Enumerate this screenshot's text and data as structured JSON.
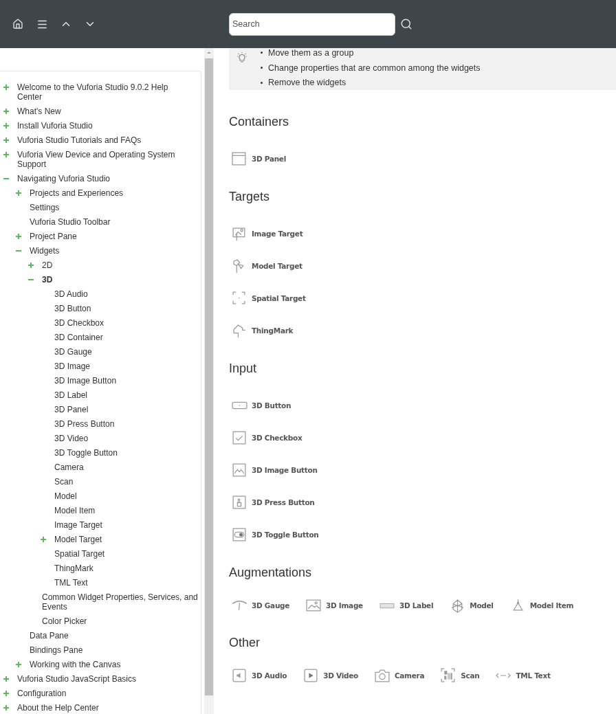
{
  "header": {
    "search": {
      "placeholder": "Search"
    }
  },
  "toc": [
    {
      "label": "Welcome to the Vuforia Studio 9.0.2 Help Center",
      "selected": false,
      "expanded": false
    },
    {
      "label": "What's New",
      "selected": false,
      "expanded": false
    },
    {
      "label": "Install Vuforia Studio",
      "selected": false,
      "expanded": false
    },
    {
      "label": "Vuforia Studio Tutorials and FAQs",
      "selected": false,
      "expanded": false
    },
    {
      "label": "Vuforia View Device and Operating System Support",
      "selected": false,
      "expanded": false
    },
    {
      "label": "Navigating Vuforia Studio",
      "selected": false,
      "expanded": true,
      "children": [
        {
          "label": "Projects and Experiences",
          "selected": false,
          "expanded": false
        },
        {
          "label": "Settings",
          "selected": false
        },
        {
          "label": "Vuforia Studio Toolbar",
          "selected": false
        },
        {
          "label": "Project Pane",
          "selected": false,
          "expanded": false
        },
        {
          "label": "Widgets",
          "selected": false,
          "expanded": true,
          "children": [
            {
              "label": "2D",
              "selected": false,
              "expanded": false
            },
            {
              "label": "3D",
              "selected": true,
              "expanded": true,
              "children": [
                {
                  "label": "3D Audio",
                  "selected": false
                },
                {
                  "label": "3D Button",
                  "selected": false
                },
                {
                  "label": "3D Checkbox",
                  "selected": false
                },
                {
                  "label": "3D Container",
                  "selected": false
                },
                {
                  "label": "3D Gauge",
                  "selected": false
                },
                {
                  "label": "3D Image",
                  "selected": false
                },
                {
                  "label": "3D Image Button",
                  "selected": false
                },
                {
                  "label": "3D Label",
                  "selected": false
                },
                {
                  "label": "3D Panel",
                  "selected": false
                },
                {
                  "label": "3D Press Button",
                  "selected": false
                },
                {
                  "label": "3D Video",
                  "selected": false
                },
                {
                  "label": "3D Toggle Button",
                  "selected": false
                },
                {
                  "label": "Camera",
                  "selected": false
                },
                {
                  "label": "Scan",
                  "selected": false
                },
                {
                  "label": "Model",
                  "selected": false
                },
                {
                  "label": "Model Item",
                  "selected": false
                },
                {
                  "label": "Image Target",
                  "selected": false
                },
                {
                  "label": "Model Target",
                  "selected": false,
                  "expanded": false
                },
                {
                  "label": "Spatial Target",
                  "selected": false
                },
                {
                  "label": "ThingMark",
                  "selected": false
                },
                {
                  "label": "TML Text",
                  "selected": false
                }
              ]
            },
            {
              "label": "Common Widget Properties, Services, and Events",
              "selected": false
            },
            {
              "label": "Color Picker",
              "selected": false
            }
          ]
        },
        {
          "label": "Data Pane",
          "selected": false
        },
        {
          "label": "Bindings Pane",
          "selected": false
        },
        {
          "label": "Working with the Canvas",
          "selected": false,
          "expanded": false
        }
      ]
    },
    {
      "label": "Vuforia Studio JavaScript Basics",
      "selected": false,
      "expanded": false
    },
    {
      "label": "Configuration",
      "selected": false,
      "expanded": false
    },
    {
      "label": "About the Help Center",
      "selected": false,
      "expanded": false
    }
  ],
  "note": {
    "bullets": [
      "Move them as a group",
      "Change properties that are common among the widgets",
      "Remove the widgets"
    ]
  },
  "sections": [
    {
      "title": "Containers",
      "horizontal": false,
      "items": [
        "3D Panel"
      ]
    },
    {
      "title": "Targets",
      "horizontal": false,
      "items": [
        "Image Target",
        "Model Target",
        "Spatial Target",
        "ThingMark"
      ]
    },
    {
      "title": "Input",
      "horizontal": false,
      "items": [
        "3D Button",
        "3D Checkbox",
        "3D Image Button",
        "3D Press Button",
        "3D Toggle Button"
      ]
    },
    {
      "title": "Augmentations",
      "horizontal": true,
      "items": [
        "3D Gauge",
        "3D Image",
        "3D Label",
        "Model",
        "Model Item"
      ]
    },
    {
      "title": "Other",
      "horizontal": true,
      "items": [
        "3D Audio",
        "3D Video",
        "Camera",
        "Scan",
        "TML Text"
      ]
    }
  ]
}
